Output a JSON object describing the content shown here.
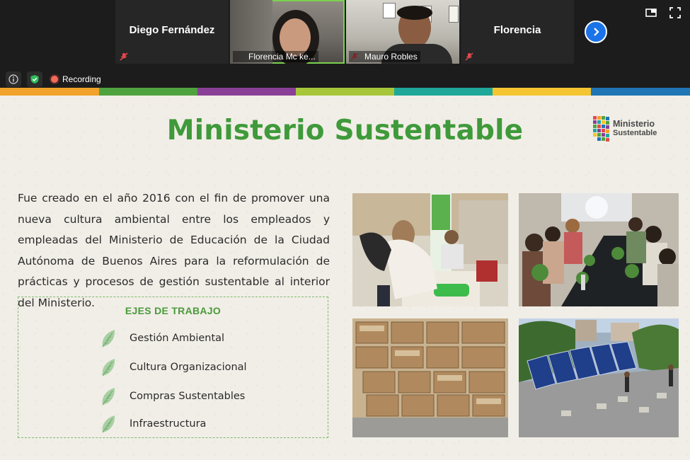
{
  "participants": [
    {
      "name": "Diego Fernández",
      "muted": true,
      "video": false
    },
    {
      "name": "Florencia Mc ke...",
      "muted": false,
      "video": true,
      "active": true
    },
    {
      "name": "Mauro Robles",
      "muted": true,
      "video": true
    },
    {
      "name": "Florencia",
      "muted": true,
      "video": false
    }
  ],
  "status": {
    "recording_label": "Recording"
  },
  "slide": {
    "title": "Ministerio Sustentable",
    "logo_line1": "Ministerio",
    "logo_line2": "Sustentable",
    "paragraph": "Fue creado en el año 2016 con el fin de promover una nueva cultura ambiental entre los empleados y empleadas del Ministerio de Educación de la Ciudad  Autónoma de Buenos Aires para la reformulación de prácticas y procesos de gestión sustentable al interior del Ministerio.",
    "ejes_title": "EJES DE TRABAJO",
    "ejes": [
      "Gestión Ambiental",
      "Cultura Organizacional",
      "Compras Sustentables",
      "Infraestructura"
    ],
    "stripe_colors": [
      "#f0a22a",
      "#4fa33f",
      "#8a3f97",
      "#a7c63a",
      "#1fa89a",
      "#f4c531",
      "#1f75b5"
    ]
  },
  "colors": {
    "title_green": "#3f9a3a",
    "active_border": "#7bd14f",
    "next_button": "#1a73e8"
  }
}
